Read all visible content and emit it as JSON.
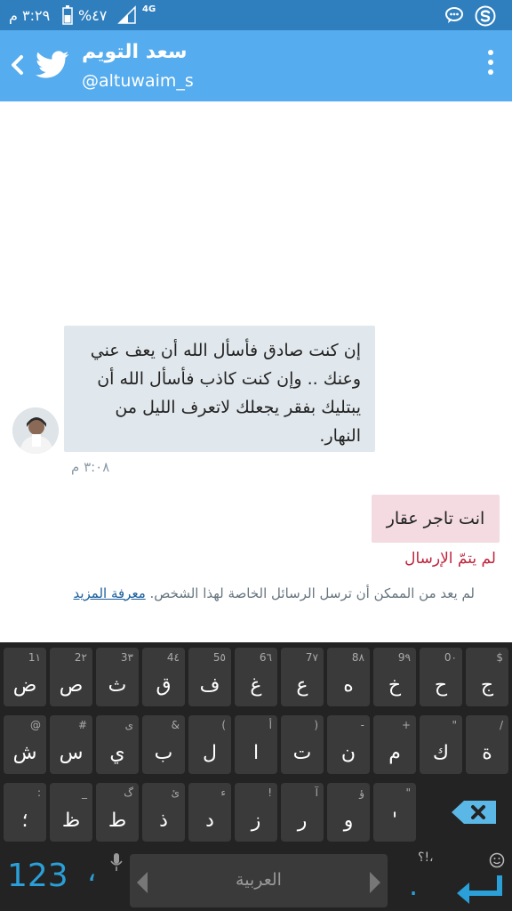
{
  "status_bar": {
    "time": "٣:٢٩ م",
    "battery": "%٤٧",
    "network": "4G"
  },
  "header": {
    "name": "سعد التويم",
    "handle": "@altuwaim_s"
  },
  "messages": [
    {
      "direction": "in",
      "text": "إن كنت صادق فأسأل الله أن يعف عني وعنك .. وإن كنت كاذب فأسأل الله أن يبتليك بفقر يجعلك لاتعرف الليل من النهار.",
      "time": "٣:٠٨ م"
    },
    {
      "direction": "out",
      "text": "انت تاجر عقار",
      "status": "لم يتمّ الإرسال"
    }
  ],
  "notice": {
    "text": "لم يعد من الممكن أن ترسل الرسائل الخاصة لهذا الشخص.",
    "link": "معرفة المزيد"
  },
  "keyboard": {
    "row1": [
      {
        "main": "ج",
        "hint": "$"
      },
      {
        "main": "ح",
        "hint": "0٠"
      },
      {
        "main": "خ",
        "hint": "9٩"
      },
      {
        "main": "ه",
        "hint": "8٨"
      },
      {
        "main": "ع",
        "hint": "7٧"
      },
      {
        "main": "غ",
        "hint": "6٦"
      },
      {
        "main": "ف",
        "hint": "5٥"
      },
      {
        "main": "ق",
        "hint": "4٤"
      },
      {
        "main": "ث",
        "hint": "3٣"
      },
      {
        "main": "ص",
        "hint": "2٢"
      },
      {
        "main": "ض",
        "hint": "1١"
      }
    ],
    "row2": [
      {
        "main": "ة",
        "hint": "/"
      },
      {
        "main": "ك",
        "hint": "\""
      },
      {
        "main": "م",
        "hint": "+"
      },
      {
        "main": "ن",
        "hint": "-"
      },
      {
        "main": "ت",
        "hint": ")"
      },
      {
        "main": "ا",
        "hint": "أ"
      },
      {
        "main": "ل",
        "hint": "("
      },
      {
        "main": "ب",
        "hint": "&"
      },
      {
        "main": "ي",
        "hint": "ى"
      },
      {
        "main": "س",
        "hint": "#"
      },
      {
        "main": "ش",
        "hint": "@"
      }
    ],
    "row3": [
      {
        "main": "'",
        "hint": "\""
      },
      {
        "main": "و",
        "hint": "ؤ"
      },
      {
        "main": "ر",
        "hint": "آ"
      },
      {
        "main": "ز",
        "hint": "!"
      },
      {
        "main": "د",
        "hint": "ء"
      },
      {
        "main": "ذ",
        "hint": "ئ"
      },
      {
        "main": "ط",
        "hint": "گ"
      },
      {
        "main": "ظ",
        "hint": "_"
      },
      {
        "main": "؛",
        "hint": ":"
      }
    ],
    "num_label": "123",
    "comma": "،",
    "space_label": "العربية",
    "punct_hint": "؟!،",
    "period": "."
  },
  "colors": {
    "status_bar": "#2f7fbf",
    "app_bar": "#55acee",
    "incoming_bubble": "#e1e8ed",
    "outgoing_bubble": "#f3dbe1",
    "error_text": "#c0243c",
    "keyboard_bg": "#232323",
    "key_bg": "#3a3a3a",
    "accent": "#2a9fd8"
  }
}
